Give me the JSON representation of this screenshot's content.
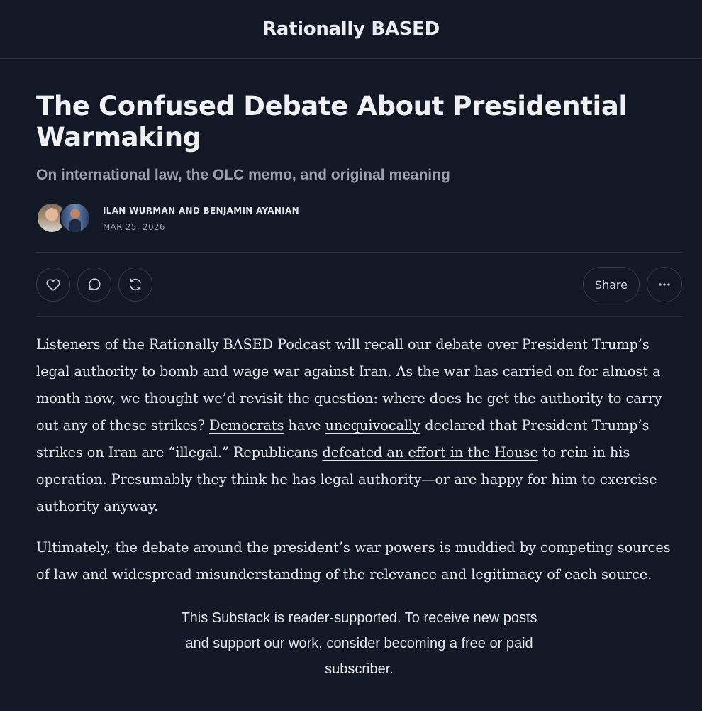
{
  "header": {
    "publication_name": "Rationally BASED"
  },
  "post": {
    "title": "The Confused Debate About Presidential Warmaking",
    "subtitle": "On international law, the OLC memo, and original meaning",
    "authors": "ILAN WURMAN AND BENJAMIN AYANIAN",
    "date": "MAR 25, 2026",
    "avatars": [
      "avatar-ilan-wurman",
      "avatar-benjamin-ayanian"
    ]
  },
  "actions": {
    "like_icon": "heart-icon",
    "comment_icon": "comment-icon",
    "restack_icon": "restack-icon",
    "share_label": "Share",
    "more_icon": "ellipsis-icon"
  },
  "body": {
    "p1": {
      "t1": "Listeners of the Rationally BASED Podcast will recall our debate over President Trump’s legal authority to bomb and wage war against Iran. As the war has carried on for almost a month now, we thought we’d revisit the question: where does he get the authority to carry out any of these strikes? ",
      "link1": "Democrats",
      "t2": " have ",
      "link2": "unequivocally",
      "t3": " declared that President Trump’s strikes on Iran are “illegal.” Republicans ",
      "link3": "defeated an effort in the House",
      "t4": " to rein in his operation. Presumably they think he has legal authority—or are happy for him to exercise authority anyway."
    },
    "p2": "Ultimately, the debate around the president’s war powers is muddied by competing sources of law and widespread misunderstanding of the relevance and legitimacy of each source."
  },
  "subscribe_prompt": "This Substack is reader-supported. To receive new posts and support our work, consider becoming a free or paid subscriber."
}
